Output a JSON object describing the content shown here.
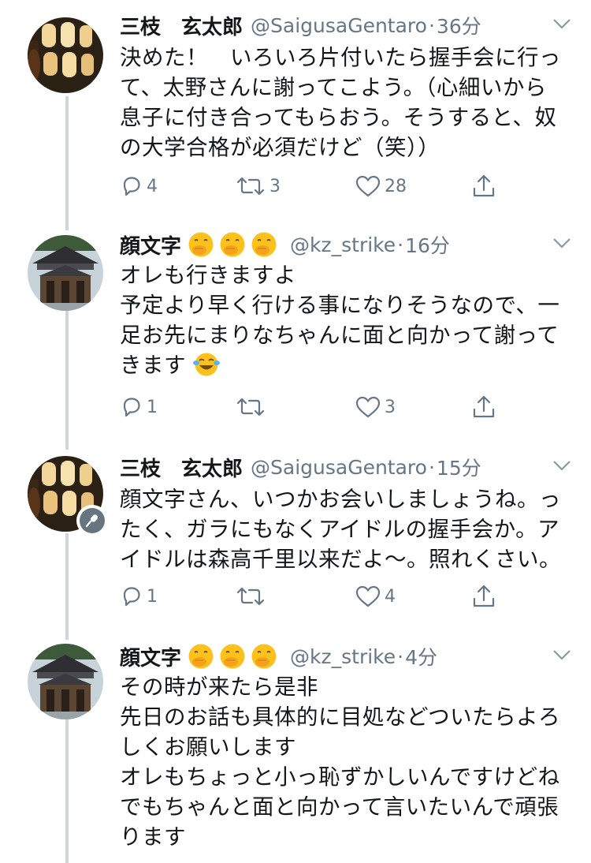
{
  "tweets": [
    {
      "name": "三枝　玄太郎",
      "handle": "@SaigusaGentaro",
      "separator": "·",
      "time": "36分",
      "avatar_icon": "lantern-photo-avatar",
      "lines": [
        "決めた！　いろいろ片付いたら握手会に行っ",
        "て、太野さんに謝ってこよう。（心細いから",
        "息子に付き合ってもらおう。そうすると、奴",
        "の大学合格が必須だけど（笑））"
      ],
      "replies": "4",
      "retweets": "3",
      "likes": "28"
    },
    {
      "name": "顔文字",
      "handle": "@kz_strike",
      "separator": "·",
      "time": "16分",
      "avatar_icon": "shrine-photo-avatar",
      "emoji_icons": [
        "face-with-hand-over-mouth-emoji",
        "face-with-hand-over-mouth-emoji",
        "face-with-hand-over-mouth-emoji"
      ],
      "lines": [
        "オレも行きますよ",
        "予定より早く行ける事になりそうなので、一",
        "足お先にまりなちゃんに面と向かって謝って",
        "きます"
      ],
      "trailing_emoji": "tears-of-joy-emoji",
      "replies": "1",
      "retweets": "",
      "likes": "3"
    },
    {
      "name": "三枝　玄太郎",
      "handle": "@SaigusaGentaro",
      "separator": "·",
      "time": "15分",
      "avatar_icon": "lantern-photo-avatar",
      "badge_icon": "microphone-icon",
      "lines": [
        "顔文字さん、いつかお会いしましょうね。っ",
        "たく、ガラにもなくアイドルの握手会か。ア",
        "イドルは森高千里以来だよ〜。照れくさい。"
      ],
      "replies": "1",
      "retweets": "",
      "likes": "4"
    },
    {
      "name": "顔文字",
      "handle": "@kz_strike",
      "separator": "·",
      "time": "4分",
      "avatar_icon": "shrine-photo-avatar",
      "emoji_icons": [
        "face-with-hand-over-mouth-emoji",
        "face-with-hand-over-mouth-emoji",
        "face-with-hand-over-mouth-emoji"
      ],
      "lines": [
        "その時が来たら是非",
        "先日のお話も具体的に目処などついたらよろ",
        "しくお願いします",
        "オレもちょっと小っ恥ずかしいんですけどね",
        "でもちゃんと面と向かって言いたいんで頑張",
        "ります"
      ]
    }
  ],
  "colors": {
    "text": "#14171a",
    "secondary": "#657786",
    "thread_line": "#ccd6dd",
    "emoji_yellow": "#fcc21b"
  },
  "icons": {
    "reply": "reply-icon",
    "retweet": "retweet-icon",
    "like": "heart-icon",
    "share": "share-icon",
    "more": "chevron-down-icon"
  }
}
